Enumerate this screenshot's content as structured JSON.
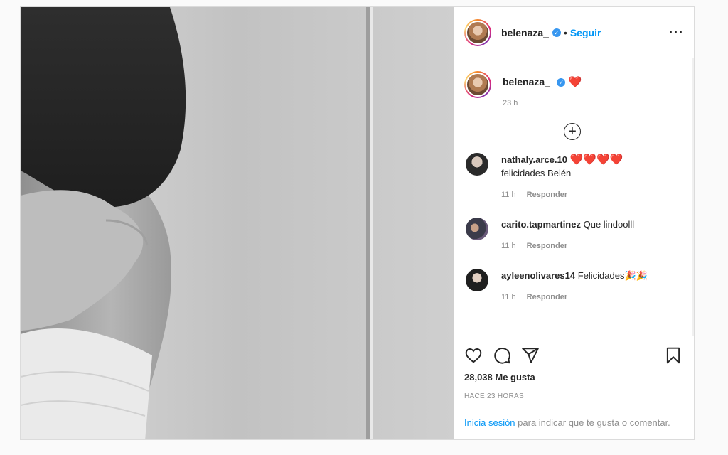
{
  "post": {
    "author": {
      "username": "belenaza_",
      "verified": true,
      "follow_label": "Seguir",
      "dot": "•",
      "more_icon": "more-options-icon"
    },
    "caption": {
      "username": "belenaza_",
      "emoji": "❤️",
      "time": "23 h"
    },
    "load_more_icon": "plus-circle-icon",
    "comments": [
      {
        "username": "nathaly.arce.10",
        "text": "❤️❤️❤️❤️",
        "text2": "felicidades Belén",
        "time": "11 h",
        "reply_label": "Responder"
      },
      {
        "username": "carito.tapmartinez",
        "text": "Que lindoolll",
        "text2": "",
        "time": "11 h",
        "reply_label": "Responder"
      },
      {
        "username": "ayleenolivares14",
        "text": "Felicidades🎉🎉",
        "text2": "",
        "time": "11 h",
        "reply_label": "Responder"
      }
    ],
    "actions": {
      "like_icon": "heart-icon",
      "comment_icon": "comment-icon",
      "share_icon": "share-icon",
      "save_icon": "bookmark-icon"
    },
    "likes": "28,038 Me gusta",
    "posted_ago": "HACE 23 HORAS",
    "login_prompt": {
      "link": "Inicia sesión",
      "rest": " para indicar que te gusta o comentar."
    }
  },
  "colors": {
    "accent": "#0095f6",
    "heart": "#e0245e",
    "muted": "#8e8e8e"
  }
}
